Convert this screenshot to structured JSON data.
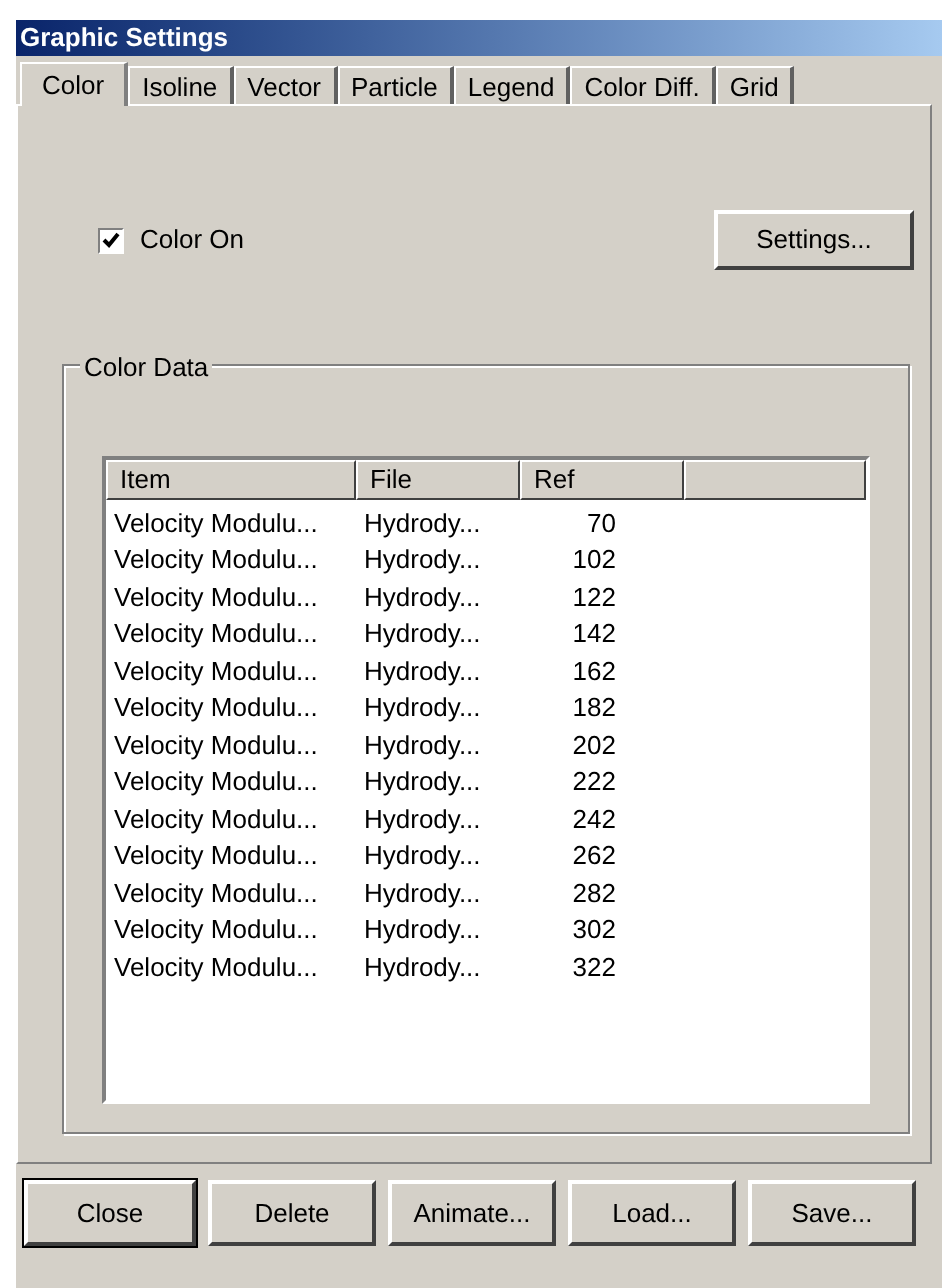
{
  "window": {
    "title": "Graphic Settings"
  },
  "tabs": [
    {
      "label": "Color",
      "selected": true
    },
    {
      "label": "Isoline",
      "selected": false
    },
    {
      "label": "Vector",
      "selected": false
    },
    {
      "label": "Particle",
      "selected": false
    },
    {
      "label": "Legend",
      "selected": false
    },
    {
      "label": "Color Diff.",
      "selected": false
    },
    {
      "label": "Grid",
      "selected": false
    }
  ],
  "color_on": {
    "label": "Color On",
    "checked": true
  },
  "settings_button": "Settings...",
  "color_data": {
    "title": "Color Data",
    "columns": [
      "Item",
      "File",
      "Ref"
    ],
    "rows": [
      [
        "Velocity Modulu...",
        "Hydrody...",
        "70"
      ],
      [
        "Velocity Modulu...",
        "Hydrody...",
        "102"
      ],
      [
        "Velocity Modulu...",
        "Hydrody...",
        "122"
      ],
      [
        "Velocity Modulu...",
        "Hydrody...",
        "142"
      ],
      [
        "Velocity Modulu...",
        "Hydrody...",
        "162"
      ],
      [
        "Velocity Modulu...",
        "Hydrody...",
        "182"
      ],
      [
        "Velocity Modulu...",
        "Hydrody...",
        "202"
      ],
      [
        "Velocity Modulu...",
        "Hydrody...",
        "222"
      ],
      [
        "Velocity Modulu...",
        "Hydrody...",
        "242"
      ],
      [
        "Velocity Modulu...",
        "Hydrody...",
        "262"
      ],
      [
        "Velocity Modulu...",
        "Hydrody...",
        "282"
      ],
      [
        "Velocity Modulu...",
        "Hydrody...",
        "302"
      ],
      [
        "Velocity Modulu...",
        "Hydrody...",
        "322"
      ]
    ]
  },
  "buttons": [
    {
      "label": "Close",
      "kind": "default"
    },
    {
      "label": "Delete",
      "kind": "normal"
    },
    {
      "label": "Animate...",
      "kind": "normal"
    },
    {
      "label": "Load...",
      "kind": "normal"
    },
    {
      "label": "Save...",
      "kind": "normal"
    }
  ]
}
